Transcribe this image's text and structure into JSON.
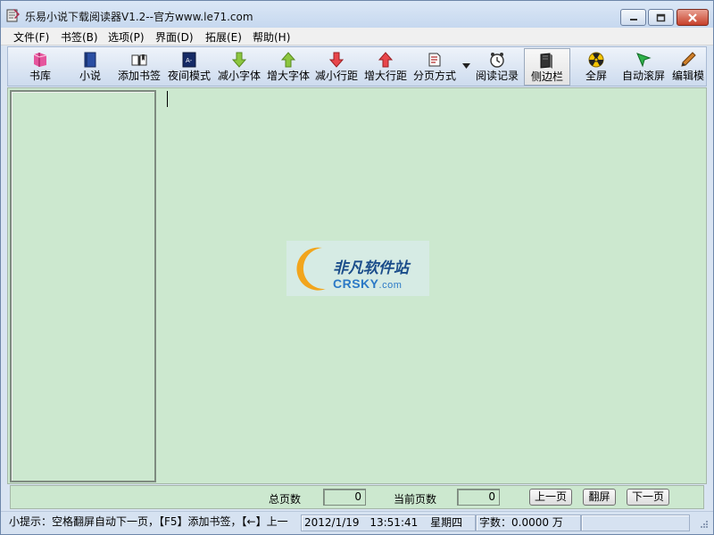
{
  "window": {
    "title": "乐易小说下载阅读器V1.2--官方www.le71.com",
    "buttons": {
      "minimize": "minimize",
      "maximize": "maximize",
      "close": "close"
    }
  },
  "menu": [
    {
      "label": "文件(F)"
    },
    {
      "label": "书签(B)"
    },
    {
      "label": "选项(P)"
    },
    {
      "label": "界面(D)"
    },
    {
      "label": "拓展(E)"
    },
    {
      "label": "帮助(H)"
    }
  ],
  "toolbar": {
    "buttons": [
      {
        "label": "书库",
        "icon": "book-shelf-icon"
      },
      {
        "label": "小说",
        "icon": "novel-book-icon"
      },
      {
        "label": "添加书签",
        "icon": "open-book-bookmark-icon"
      },
      {
        "label": "夜间模式",
        "icon": "night-mode-icon"
      },
      {
        "label": "减小字体",
        "icon": "arrow-down-green-icon"
      },
      {
        "label": "增大字体",
        "icon": "arrow-up-green-icon"
      },
      {
        "label": "减小行距",
        "icon": "arrow-down-red-icon"
      },
      {
        "label": "增大行距",
        "icon": "arrow-up-red-icon"
      },
      {
        "label": "分页方式",
        "icon": "paging-icon"
      },
      {
        "label": "阅读记录",
        "icon": "clock-icon"
      },
      {
        "label": "侧边栏",
        "icon": "sidebar-book-icon",
        "active": true
      },
      {
        "label": "全屏",
        "icon": "fullscreen-radiation-icon"
      },
      {
        "label": "自动滚屏",
        "icon": "cursor-arrow-icon"
      },
      {
        "label": "编辑模",
        "icon": "pencil-icon"
      }
    ],
    "dropdown_icon": "chevron-down-icon"
  },
  "watermark": {
    "cn_text": "非凡软件站",
    "en_text": "CRSKY",
    "en_suffix": ".com"
  },
  "pagebar": {
    "total_pages_label": "总页数",
    "total_pages_value": "0",
    "current_page_label": "当前页数",
    "current_page_value": "0",
    "prev_label": "上一页",
    "flip_label": "翻屏",
    "next_label": "下一页"
  },
  "status": {
    "tip": "小提示：空格翻屏自动下一页，【F5】添加书签，【←】上一",
    "date": "2012/1/19",
    "time": "13:51:41",
    "weekday": "星期四",
    "word_count": "字数：0.0000 万"
  },
  "colors": {
    "reading_bg": "#cce8cf",
    "chrome_bg": "#d9e4f2",
    "close_button": "#c7402a"
  }
}
